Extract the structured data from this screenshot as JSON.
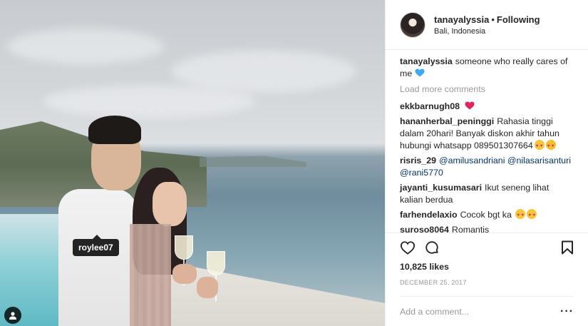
{
  "photo": {
    "tag_label": "roylee07"
  },
  "header": {
    "username": "tanayalyssia",
    "separator": "•",
    "follow_status": "Following",
    "location": "Bali, Indonesia"
  },
  "caption": {
    "username": "tanayalyssia",
    "text": "someone who really cares of me"
  },
  "load_more": "Load more comments",
  "comments": [
    {
      "user": "ekkbarnugh08",
      "text": ""
    },
    {
      "user": "hananherbal_peninggi",
      "text": "Rahasia tinggi dalam 20hari! Banyak diskon akhir tahun hubungi whatsapp 089501307664"
    },
    {
      "user": "risris_29",
      "mention1": "@amilusandriani",
      "mention2": "@nilasarisanturi",
      "mention3": "@rani5770"
    },
    {
      "user": "jayanti_kusumasari",
      "text": "Ikut seneng lihat kalian berdua"
    },
    {
      "user": "farhendelaxio",
      "text": "Cocok bgt ka"
    },
    {
      "user": "suroso8064",
      "text": "Romantis"
    }
  ],
  "actions": {
    "likes": "10,825 likes",
    "date": "December 25, 2017",
    "comment_placeholder": "Add a comment...",
    "more": "···"
  },
  "colors": {
    "heart_blue": "#3fa9f5",
    "heart_red": "#e0245e",
    "mention": "#003569",
    "muted": "#999999"
  },
  "icons": [
    "user-tag-icon",
    "like-heart-icon",
    "comment-icon",
    "bookmark-icon",
    "more-options-icon"
  ]
}
